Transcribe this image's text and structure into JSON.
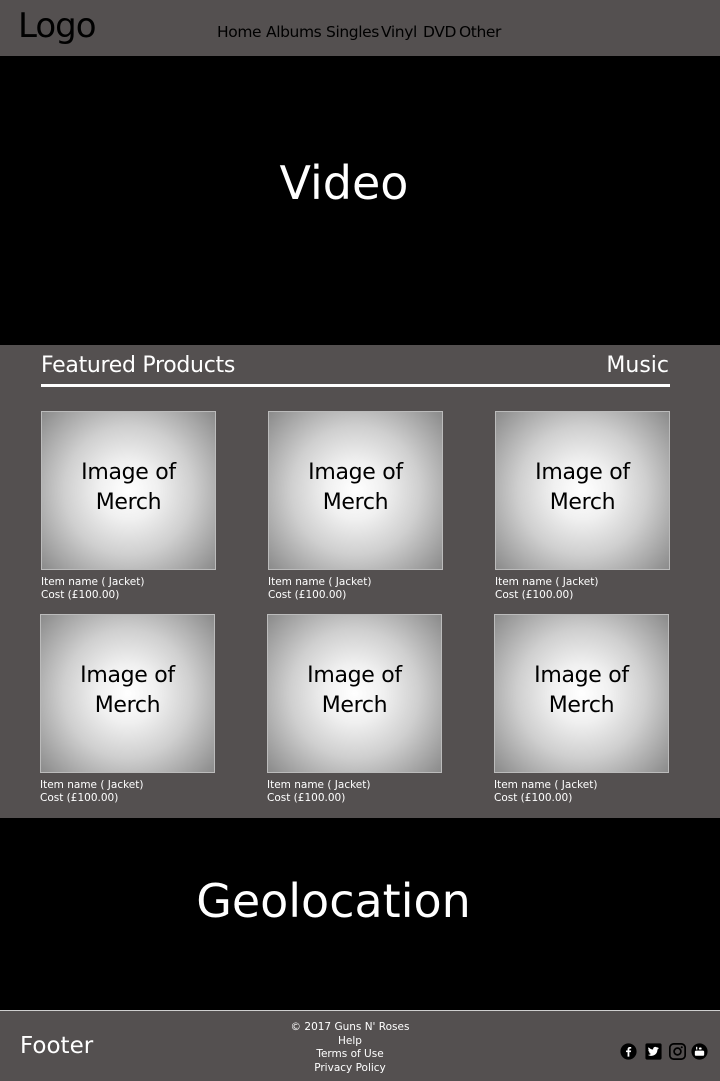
{
  "header": {
    "logo": "Logo",
    "nav": [
      "Home",
      "Albums",
      "Singles",
      "Vinyl",
      "DVD",
      "Other"
    ]
  },
  "video": {
    "label": "Video"
  },
  "featured": {
    "title": "Featured Products",
    "music_link": "Music",
    "products": [
      {
        "image_label_1": "Image of",
        "image_label_2": "Merch",
        "name": "Item name ( Jacket)",
        "cost": "Cost (£100.00)"
      },
      {
        "image_label_1": "Image of",
        "image_label_2": "Merch",
        "name": "Item name ( Jacket)",
        "cost": "Cost (£100.00)"
      },
      {
        "image_label_1": "Image of",
        "image_label_2": "Merch",
        "name": "Item name ( Jacket)",
        "cost": "Cost (£100.00)"
      },
      {
        "image_label_1": "Image of",
        "image_label_2": "Merch",
        "name": "Item name ( Jacket)",
        "cost": "Cost (£100.00)"
      },
      {
        "image_label_1": "Image of",
        "image_label_2": "Merch",
        "name": "Item name ( Jacket)",
        "cost": "Cost (£100.00)"
      },
      {
        "image_label_1": "Image of",
        "image_label_2": "Merch",
        "name": "Item name ( Jacket)",
        "cost": "Cost (£100.00)"
      }
    ]
  },
  "geolocation": {
    "label": "Geolocation"
  },
  "footer": {
    "label": "Footer",
    "copyright": "© 2017 Guns N' Roses",
    "links": [
      "Help",
      "Terms of Use",
      "Privacy Policy"
    ],
    "social_icons": [
      "facebook-icon",
      "twitter-icon",
      "instagram-icon",
      "youtube-icon"
    ]
  }
}
